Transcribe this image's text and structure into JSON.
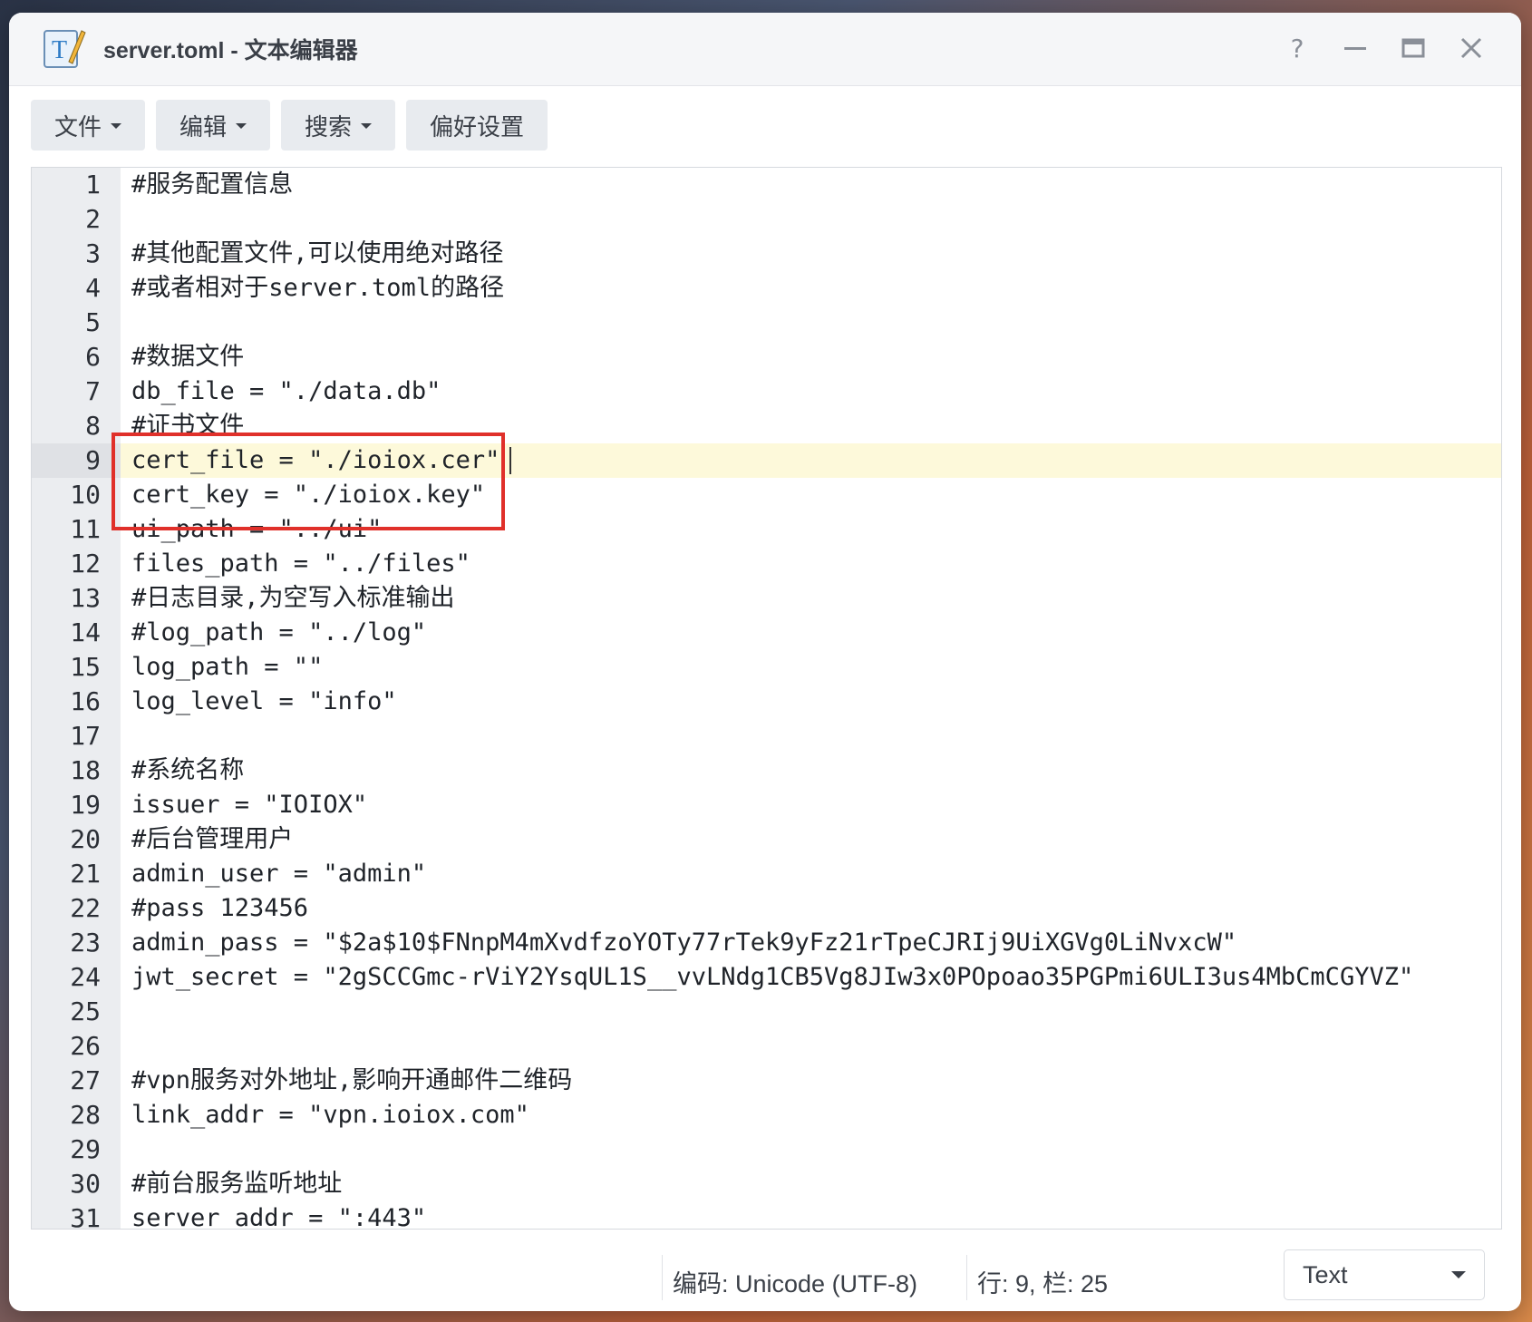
{
  "window": {
    "title": "server.toml - 文本编辑器",
    "controls": {
      "help": "help-icon",
      "minimize": "minimize-icon",
      "maximize": "maximize-icon",
      "close": "close-icon"
    }
  },
  "toolbar": {
    "file_label": "文件",
    "edit_label": "编辑",
    "search_label": "搜索",
    "prefs_label": "偏好设置"
  },
  "editor": {
    "active_line": 9,
    "lines": [
      {
        "n": "1",
        "text": "#服务配置信息"
      },
      {
        "n": "2",
        "text": ""
      },
      {
        "n": "3",
        "text": "#其他配置文件,可以使用绝对路径"
      },
      {
        "n": "4",
        "text": "#或者相对于server.toml的路径"
      },
      {
        "n": "5",
        "text": ""
      },
      {
        "n": "6",
        "text": "#数据文件"
      },
      {
        "n": "7",
        "text": "db_file = \"./data.db\""
      },
      {
        "n": "8",
        "text": "#证书文件"
      },
      {
        "n": "9",
        "text": "cert_file = \"./ioiox.cer\""
      },
      {
        "n": "10",
        "text": "cert_key = \"./ioiox.key\""
      },
      {
        "n": "11",
        "text": "ui_path = \"../ui\""
      },
      {
        "n": "12",
        "text": "files_path = \"../files\""
      },
      {
        "n": "13",
        "text": "#日志目录,为空写入标准输出"
      },
      {
        "n": "14",
        "text": "#log_path = \"../log\""
      },
      {
        "n": "15",
        "text": "log_path = \"\""
      },
      {
        "n": "16",
        "text": "log_level = \"info\""
      },
      {
        "n": "17",
        "text": ""
      },
      {
        "n": "18",
        "text": "#系统名称"
      },
      {
        "n": "19",
        "text": "issuer = \"IOIOX\""
      },
      {
        "n": "20",
        "text": "#后台管理用户"
      },
      {
        "n": "21",
        "text": "admin_user = \"admin\""
      },
      {
        "n": "22",
        "text": "#pass 123456"
      },
      {
        "n": "23",
        "text": "admin_pass = \"$2a$10$FNnpM4mXvdfzoYOTy77rTek9yFz21rTpeCJRIj9UiXGVg0LiNvxcW\""
      },
      {
        "n": "24",
        "text": "jwt_secret = \"2gSCCGmc-rViY2YsqUL1S__vvLNdg1CB5Vg8JIw3x0POpoao35PGPmi6ULI3us4MbCmCGYVZ\""
      },
      {
        "n": "25",
        "text": ""
      },
      {
        "n": "26",
        "text": ""
      },
      {
        "n": "27",
        "text": "#vpn服务对外地址,影响开通邮件二维码"
      },
      {
        "n": "28",
        "text": "link_addr = \"vpn.ioiox.com\""
      },
      {
        "n": "29",
        "text": ""
      },
      {
        "n": "30",
        "text": "#前台服务监听地址"
      },
      {
        "n": "31",
        "text": "server_addr = \":443\""
      }
    ]
  },
  "statusbar": {
    "encoding": "编码: Unicode (UTF-8)",
    "position": "行: 9, 栏: 25",
    "mode": "Text"
  },
  "colors": {
    "highlight_box": "#e0302a",
    "active_line": "#fdf9da"
  }
}
